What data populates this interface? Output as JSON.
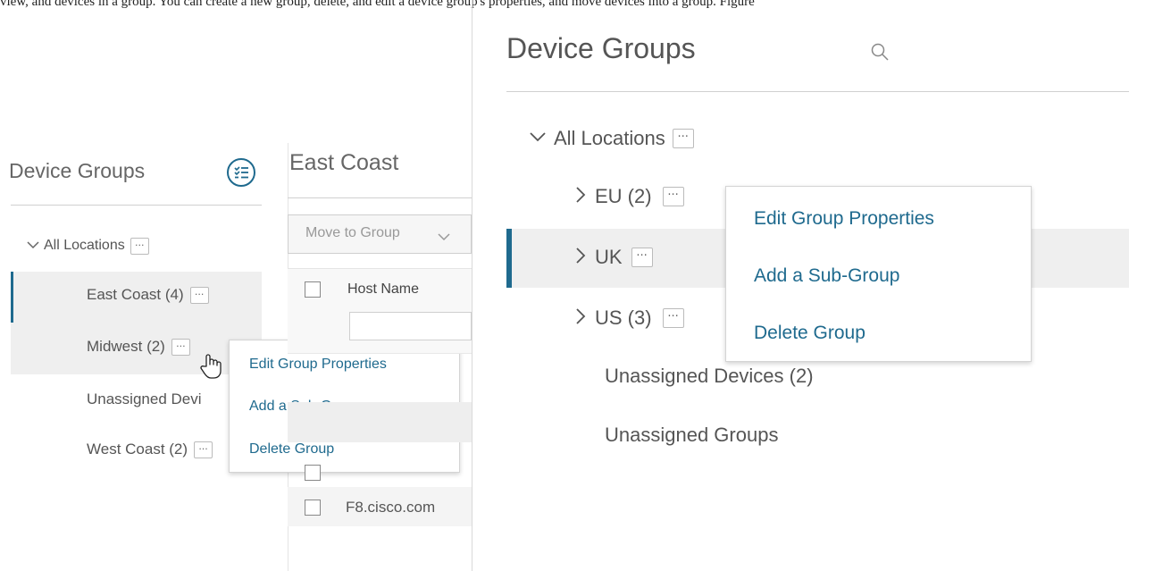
{
  "caption": "view, and devices in a group. You can create a new group, delete, and edit a device group's properties, and move devices into a group. Figure",
  "left_panel": {
    "title": "Device Groups",
    "root": {
      "label": "All Locations"
    },
    "items": [
      {
        "label": "East Coast (4)",
        "selected": true
      },
      {
        "label": "Midwest (2)"
      },
      {
        "label": "Unassigned Devi"
      },
      {
        "label": "West Coast (2)"
      }
    ],
    "context_menu": [
      "Edit Group Properties",
      "Add a Sub-Group",
      "Delete Group"
    ]
  },
  "middle_panel": {
    "title": "East Coast",
    "move_button": "Move to Group",
    "column_header": "Host Name",
    "rows": [
      {
        "host": "F8.cisco.com"
      }
    ]
  },
  "right_panel": {
    "title": "Device Groups",
    "root": {
      "label": "All Locations"
    },
    "items": [
      {
        "label": "EU (2)",
        "expandable": true
      },
      {
        "label": "UK",
        "expandable": true,
        "selected": true
      },
      {
        "label": "US (3)",
        "expandable": true
      },
      {
        "label": "Unassigned Devices (2)"
      },
      {
        "label": "Unassigned Groups"
      }
    ],
    "context_menu": [
      "Edit Group Properties",
      "Add a Sub-Group",
      "Delete Group"
    ]
  },
  "colors": {
    "accent": "#1f6a8e",
    "selection_bg": "#efefef",
    "text": "#555555"
  }
}
